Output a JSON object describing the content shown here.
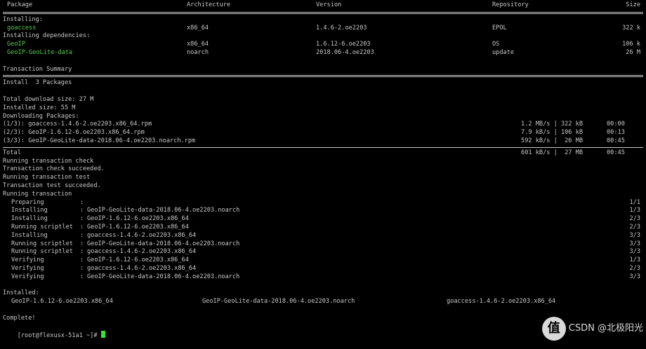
{
  "header": {
    "package": "Package",
    "architecture": "Architecture",
    "version": "Version",
    "repository": "Repository",
    "size": "Size"
  },
  "installing_label": "Installing:",
  "installing_rows": [
    {
      "package": "goaccess",
      "arch": "x86_64",
      "version": "1.4.6-2.oe2203",
      "repo": "EPOL",
      "size": "322 k"
    }
  ],
  "deps_label": "Installing dependencies:",
  "dep_rows": [
    {
      "package": "GeoIP",
      "arch": "x86_64",
      "version": "1.6.12-6.oe2203",
      "repo": "OS",
      "size": "106 k"
    },
    {
      "package": "GeoIP-GeoLite-data",
      "arch": "noarch",
      "version": "2018.06-4.oe2203",
      "repo": "update",
      "size": "26 M"
    }
  ],
  "transaction_summary": "Transaction Summary",
  "install_line": "Install  3 Packages",
  "total_download": "Total download size: 27 M",
  "installed_size": "Installed size: 55 M",
  "downloading": "Downloading Packages:",
  "downloads": [
    {
      "name": "(1/3): goaccess-1.4.6-2.oe2203.x86_64.rpm",
      "speed": "1.2 MB/s | 322 kB",
      "time": "00:00"
    },
    {
      "name": "(2/3): GeoIP-1.6.12-6.oe2203.x86_64.rpm",
      "speed": "7.9 kB/s | 106 kB",
      "time": "00:13"
    },
    {
      "name": "(3/3): GeoIP-GeoLite-data-2018.06-4.oe2203.noarch.rpm",
      "speed": "592 kB/s |  26 MB",
      "time": "00:45"
    }
  ],
  "total": {
    "label": "Total",
    "speed": "601 kB/s |  27 MB",
    "time": "00:45"
  },
  "messages": [
    "Running transaction check",
    "Transaction check succeeded.",
    "Running transaction test",
    "Transaction test succeeded.",
    "Running transaction"
  ],
  "steps": [
    {
      "action": "Preparing",
      "pkg": "",
      "count": "1/1"
    },
    {
      "action": "Installing",
      "pkg": "GeoIP-GeoLite-data-2018.06-4.oe2203.noarch",
      "count": "1/3"
    },
    {
      "action": "Installing",
      "pkg": "GeoIP-1.6.12-6.oe2203.x86_64",
      "count": "2/3"
    },
    {
      "action": "Running scriptlet",
      "pkg": "GeoIP-1.6.12-6.oe2203.x86_64",
      "count": "2/3"
    },
    {
      "action": "Installing",
      "pkg": "goaccess-1.4.6-2.oe2203.x86_64",
      "count": "3/3"
    },
    {
      "action": "Running scriptlet",
      "pkg": "GeoIP-GeoLite-data-2018.06-4.oe2203.noarch",
      "count": "3/3"
    },
    {
      "action": "Running scriptlet",
      "pkg": "goaccess-1.4.6-2.oe2203.x86_64",
      "count": "3/3"
    },
    {
      "action": "Verifying",
      "pkg": "GeoIP-1.6.12-6.oe2203.x86_64",
      "count": "1/3"
    },
    {
      "action": "Verifying",
      "pkg": "goaccess-1.4.6-2.oe2203.x86_64",
      "count": "2/3"
    },
    {
      "action": "Verifying",
      "pkg": "GeoIP-GeoLite-data-2018.06-4.oe2203.noarch",
      "count": "3/3"
    }
  ],
  "installed_label": "Installed:",
  "installed": [
    "GeoIP-1.6.12-6.oe2203.x86_64",
    "GeoIP-GeoLite-data-2018.06-4.oe2203.noarch",
    "goaccess-1.4.6-2.oe2203.x86_64"
  ],
  "complete": "Complete!",
  "prompt": "[root@flexusx-51a1 ~]# ",
  "watermark": {
    "text": "CSDN @北极阳光",
    "logo": "值"
  },
  "colors": {
    "background": "#000000",
    "text": "#c8c8c8",
    "package_green": "#55d04b",
    "cursor": "#2fe82f"
  }
}
